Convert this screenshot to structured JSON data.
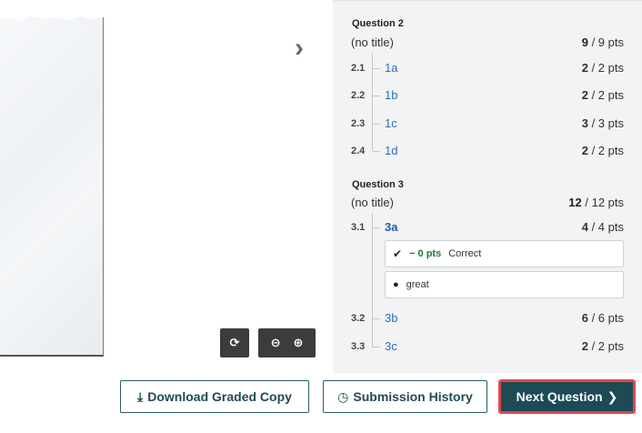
{
  "viewer": {
    "next_page_glyph": "›",
    "rotate_glyph": "⟳",
    "zoom_out_glyph": "⊖",
    "zoom_in_glyph": "⊕"
  },
  "outline": {
    "questions": [
      {
        "label": "Question 2",
        "title": "(no title)",
        "score": "9",
        "total": " / 9 pts",
        "subs": [
          {
            "num": "2.1",
            "name": "1a",
            "score": "2",
            "total": " / 2 pts"
          },
          {
            "num": "2.2",
            "name": "1b",
            "score": "2",
            "total": " / 2 pts"
          },
          {
            "num": "2.3",
            "name": "1c",
            "score": "3",
            "total": " / 3 pts"
          },
          {
            "num": "2.4",
            "name": "1d",
            "score": "2",
            "total": " / 2 pts"
          }
        ]
      },
      {
        "label": "Question 3",
        "title": "(no title)",
        "score": "12",
        "total": " / 12 pts",
        "subs": [
          {
            "num": "3.1",
            "name": "3a",
            "score": "4",
            "total": " / 4 pts"
          },
          {
            "num": "3.2",
            "name": "3b",
            "score": "6",
            "total": " / 6 pts"
          },
          {
            "num": "3.3",
            "name": "3c",
            "score": "2",
            "total": " / 2 pts"
          }
        ]
      }
    ],
    "rubric_item": {
      "check": "✔",
      "delta": "− 0 pts",
      "label": "Correct"
    },
    "comment": {
      "icon": "●",
      "text": "great"
    }
  },
  "footer": {
    "download_icon": "⤓",
    "download_label": "Download Graded Copy",
    "history_icon": "◷",
    "history_label": "Submission History",
    "next_label": "Next Question",
    "next_icon": "❯"
  }
}
